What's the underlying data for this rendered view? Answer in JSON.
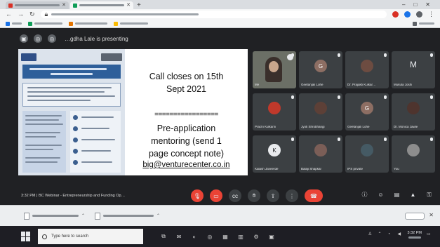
{
  "meet": {
    "presenting_banner": "…gdha Lale is presenting",
    "meeting_info": "3:32 PM | BC Webinar - Entrepreneurship and Funding Op…"
  },
  "slide": {
    "call_line1": "Call closes on 15th",
    "call_line2": "Sept 2021",
    "divider": "=================",
    "mentor_line1": "Pre-application",
    "mentor_line2": "mentoring (send 1",
    "mentor_line3": "page concept note)",
    "email": "big@venturecenter.co.in"
  },
  "participants": [
    {
      "name": "Me",
      "type": "video"
    },
    {
      "name": "Geetanjali Lohe",
      "type": "avatar",
      "color": "#8d6e63",
      "initial": "G"
    },
    {
      "name": "Dr. Prajakti Kulkar…",
      "type": "avatar",
      "color": "#6d4c41",
      "initial": ""
    },
    {
      "name": "Mukula Joshi",
      "type": "letter",
      "initial": "M"
    },
    {
      "name": "Prachi Kulkarni",
      "type": "avatar",
      "color": "#c0392b",
      "initial": ""
    },
    {
      "name": "Jyoti Shrobhangi",
      "type": "avatar",
      "color": "#5d4037",
      "initial": ""
    },
    {
      "name": "Geetanjali Lohe",
      "type": "avatar",
      "color": "#8d6e63",
      "initial": "G"
    },
    {
      "name": "Dr. Monica Jawle",
      "type": "avatar",
      "color": "#4e342e",
      "initial": ""
    },
    {
      "name": "Kalash Javeerde",
      "type": "avatar",
      "color": "#e8eaed",
      "initial": "K"
    },
    {
      "name": "Balaji Shapkar",
      "type": "avatar",
      "color": "#7b5e57",
      "initial": ""
    },
    {
      "name": "IPS private",
      "type": "avatar",
      "color": "#455a64",
      "initial": ""
    },
    {
      "name": "You",
      "type": "avatar",
      "color": "#8d8d8d",
      "initial": ""
    }
  ],
  "taskbar": {
    "search_placeholder": "Type here to search",
    "time": "3:32 PM"
  },
  "colors": {
    "meet_bg": "#202124",
    "tile_bg": "#3c4043",
    "hangup": "#ea4335",
    "slide_title_blue": "#2e5f9a"
  },
  "icons": {
    "meet_toolbar": [
      "captions-icon",
      "raise-hand-icon",
      "present-icon",
      "more-icon"
    ],
    "meet_right": [
      "info-icon",
      "people-icon",
      "chat-icon",
      "activities-icon",
      "lock-icon"
    ],
    "taskbar": [
      "task-view-icon",
      "edge-icon",
      "chrome-icon",
      "explorer-icon",
      "store-icon",
      "mail-icon",
      "settings-icon"
    ]
  }
}
